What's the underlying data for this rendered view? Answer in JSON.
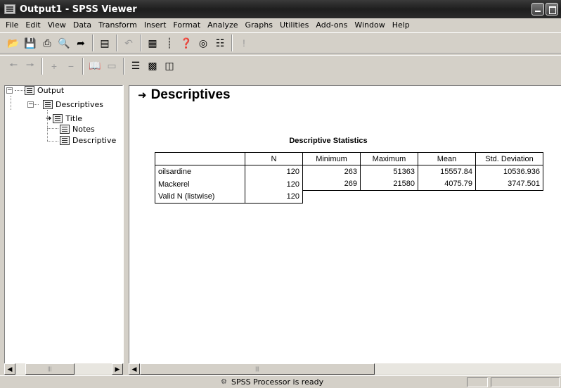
{
  "window": {
    "title": "Output1 - SPSS Viewer"
  },
  "menu": [
    "File",
    "Edit",
    "View",
    "Data",
    "Transform",
    "Insert",
    "Format",
    "Analyze",
    "Graphs",
    "Utilities",
    "Add-ons",
    "Window",
    "Help"
  ],
  "outline": {
    "root": "Output",
    "group": "Descriptives",
    "children": [
      "Title",
      "Notes",
      "Descriptive"
    ]
  },
  "content": {
    "heading": "Descriptives",
    "table": {
      "title": "Descriptive Statistics",
      "columns": [
        "",
        "N",
        "Minimum",
        "Maximum",
        "Mean",
        "Std. Deviation"
      ],
      "rows": [
        [
          "oilsardine",
          "120",
          "263",
          "51363",
          "15557.84",
          "10536.936"
        ],
        [
          "Mackerel",
          "120",
          "269",
          "21580",
          "4075.79",
          "3747.501"
        ],
        [
          "Valid N (listwise)",
          "120",
          "",
          "",
          "",
          ""
        ]
      ]
    }
  },
  "status": {
    "text": "SPSS Processor  is ready"
  },
  "icons": {
    "toolbar1": [
      "open-icon",
      "save-icon",
      "print-icon",
      "print-preview-icon",
      "export-icon",
      "dialog-recall-icon",
      "undo-icon",
      "goto-data-icon",
      "goto-case-icon",
      "variables-icon",
      "use-sets-icon",
      "select-last-output-icon",
      "designate-window-icon"
    ],
    "toolbar2": [
      "promote-icon",
      "demote-icon",
      "expand-icon",
      "collapse-icon",
      "show-icon",
      "hide-icon",
      "insert-heading-icon",
      "insert-title-icon",
      "insert-text-icon"
    ]
  }
}
